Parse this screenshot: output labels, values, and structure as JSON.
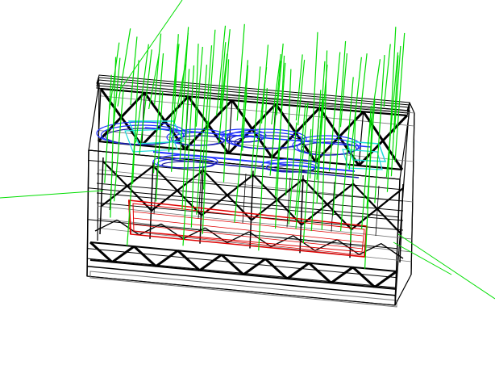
{
  "scene": {
    "background": "#ffffff",
    "colors": {
      "frame": "#000000",
      "frame_light": "#777777",
      "vector": "#00dd00",
      "blue_shape": "#2233ff",
      "blue_dark": "#1a1aa0",
      "cyan_shape": "#22d8d8",
      "red_box": "#e00000"
    },
    "truss_panel_count": 7,
    "vector_glyph_count": 64
  }
}
